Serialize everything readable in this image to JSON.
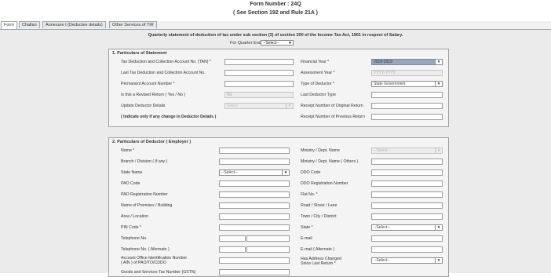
{
  "header": {
    "title": "Form Number : 24Q",
    "subtitle": "( See Section 192 and Rule 21A )"
  },
  "tabs": [
    "Form",
    "Challan",
    "Annexure I (Deductee details)",
    "Other Services of TIR"
  ],
  "statement": {
    "heading": "Quarterly statement of deduction of tax under sub section (3) of section 200 of the Income Tax Act, 1961 in respect of Salary.",
    "quarter_label": "For Quarter Ended *",
    "quarter_value": "--Select--"
  },
  "sec1": {
    "title": "1. Particulars of Statement",
    "left_labels": [
      "Tax Deduction and Collection Account No. (TAN) *",
      "Last Tax Deduction and Collection Account No.",
      "Permanent Account Number *",
      "Is this a Revised Return ( Yes / No )",
      "Update Deductor Details",
      "( Indicate only if any change in Deductor Details )"
    ],
    "revised_value": "No",
    "update_value": "Select",
    "right_labels": [
      "Financial Year *",
      "Assessment Year *",
      "Type of Deductor *",
      "Last Deductor Type",
      "Receipt Number of Original Return",
      "Receipt Number of Previous Return"
    ],
    "financial_year": "2018-2019",
    "assessment_year": "YYYY-YYYY",
    "deductor_type": "State Government"
  },
  "sec2": {
    "title": "2. Particulars of Deductor ( Employer )",
    "left_labels": [
      "Name *",
      "Branch / Division ( If any )",
      "State Name",
      "PAO Code",
      "PAO Registration Number",
      "Name of Premises / Building",
      "Area / Location",
      "PIN Code *",
      "Telephone No.",
      "Telephone No. ( Alternate )",
      "Account Office Identification Number",
      "( AIN ) of PAO/TO/CDDO",
      "Goods and Services Tax Number (GSTN)"
    ],
    "state_name_value": "--Select--",
    "right_labels": [
      "Ministry / Dept. Name",
      "Ministry / Dept. Name ( Others )",
      "DDO Code",
      "DDO Registration Number",
      "Flat No. *",
      "Road / Street / Lane",
      "Town / City / District",
      "State *",
      "E-mail",
      "E-mail ( Alternate )",
      "Has Address Changed",
      "Since Last Return *"
    ],
    "ministry_value": "--Select--",
    "state_value": "--Select--",
    "address_changed_value": "--Select--"
  }
}
